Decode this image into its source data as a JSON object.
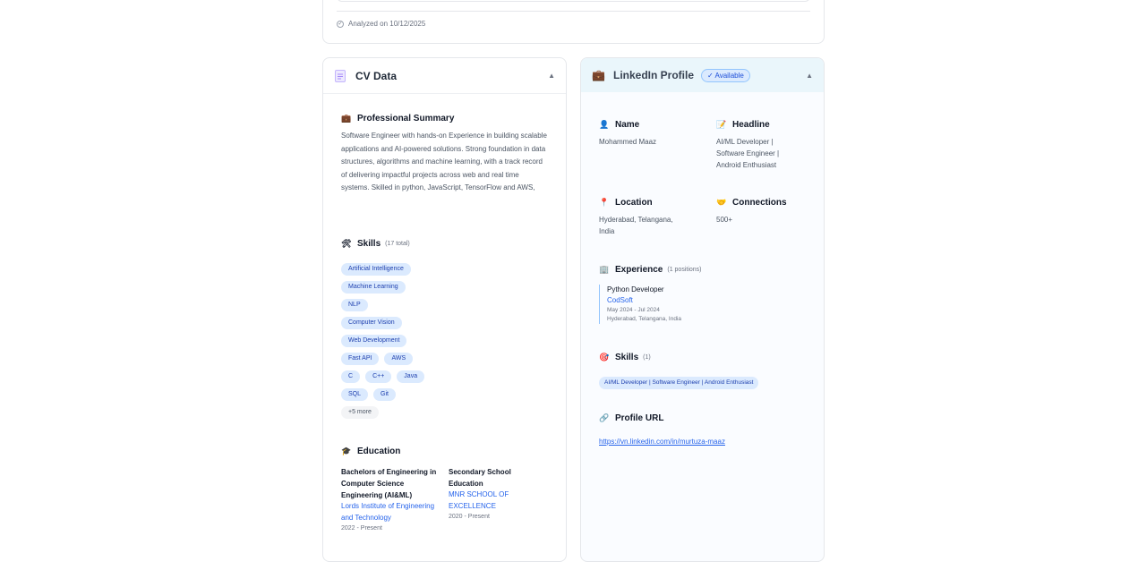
{
  "top_card": {
    "analyzed_text": "Analyzed on 10/12/2025"
  },
  "cv_panel": {
    "title": "CV Data",
    "summary": {
      "heading": "Professional Summary",
      "text": "Software Engineer with hands-on Experience in building scalable applications and AI-powered solutions. Strong foundation in data structures, algorithms and machine learning, with a track record of delivering impactful projects across web and real time systems. Skilled in python, JavaScript, TensorFlow and AWS,"
    },
    "skills": {
      "heading": "Skills",
      "count": "(17 total)",
      "rows": [
        [
          "Artificial Intelligence"
        ],
        [
          "Machine Learning"
        ],
        [
          "NLP"
        ],
        [
          "Computer Vision"
        ],
        [
          "Web Development"
        ],
        [
          "Fast API",
          "AWS"
        ],
        [
          "C",
          "C++",
          "Java"
        ],
        [
          "SQL",
          "Git"
        ]
      ],
      "more": "+5 more"
    },
    "education": {
      "heading": "Education",
      "items": [
        {
          "degree": "Bachelors of Engineering in Computer Science Engineering (AI&ML)",
          "school": "Lords Institute of Engineering and Technology",
          "years": "2022 - Present"
        },
        {
          "degree": "Secondary School Education",
          "school": "MNR SCHOOL OF EXCELLENCE",
          "years": "2020 - Present"
        }
      ]
    }
  },
  "linkedin_panel": {
    "title": "LinkedIn Profile",
    "badge": "✓ Available",
    "name": {
      "label": "Name",
      "value": "Mohammed Maaz"
    },
    "headline": {
      "label": "Headline",
      "value": "AI/ML Developer | Software Engineer | Android Enthusiast"
    },
    "location": {
      "label": "Location",
      "value": "Hyderabad, Telangana, India"
    },
    "connections": {
      "label": "Connections",
      "value": "500+"
    },
    "experience": {
      "heading": "Experience",
      "count": "(1 positions)",
      "items": [
        {
          "title": "Python Developer",
          "company": "CodSoft",
          "dates": "May 2024 - Jul 2024",
          "location": "Hyderabad, Telangana, India"
        }
      ]
    },
    "skills": {
      "heading": "Skills",
      "count": "(1)",
      "items": [
        "AI/ML Developer | Software Engineer | Android Enthusiast"
      ]
    },
    "profile_url": {
      "heading": "Profile URL",
      "url": "https://vn.linkedin.com/in/murtuza-maaz"
    }
  },
  "icons": {
    "analyzed": "check-circle-icon",
    "cv": "document-icon",
    "linkedin": "briefcase-icon",
    "summary": "briefcase-icon",
    "skills": "tools-icon",
    "education": "graduation-cap-icon",
    "name": "person-icon",
    "headline": "memo-icon",
    "location": "pin-icon",
    "connections": "handshake-icon",
    "experience": "building-icon",
    "li_skills": "target-icon",
    "url": "link-icon",
    "collapse": "caret-up-icon"
  }
}
